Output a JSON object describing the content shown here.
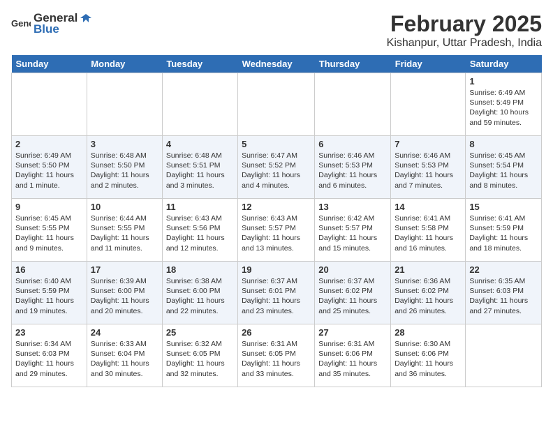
{
  "header": {
    "logo_general": "General",
    "logo_blue": "Blue",
    "title": "February 2025",
    "subtitle": "Kishanpur, Uttar Pradesh, India"
  },
  "days_of_week": [
    "Sunday",
    "Monday",
    "Tuesday",
    "Wednesday",
    "Thursday",
    "Friday",
    "Saturday"
  ],
  "weeks": [
    {
      "cells": [
        {
          "date": "",
          "content": ""
        },
        {
          "date": "",
          "content": ""
        },
        {
          "date": "",
          "content": ""
        },
        {
          "date": "",
          "content": ""
        },
        {
          "date": "",
          "content": ""
        },
        {
          "date": "",
          "content": ""
        },
        {
          "date": "1",
          "content": "Sunrise: 6:49 AM\nSunset: 5:49 PM\nDaylight: 10 hours and 59 minutes."
        }
      ]
    },
    {
      "cells": [
        {
          "date": "2",
          "content": "Sunrise: 6:49 AM\nSunset: 5:50 PM\nDaylight: 11 hours and 1 minute."
        },
        {
          "date": "3",
          "content": "Sunrise: 6:48 AM\nSunset: 5:50 PM\nDaylight: 11 hours and 2 minutes."
        },
        {
          "date": "4",
          "content": "Sunrise: 6:48 AM\nSunset: 5:51 PM\nDaylight: 11 hours and 3 minutes."
        },
        {
          "date": "5",
          "content": "Sunrise: 6:47 AM\nSunset: 5:52 PM\nDaylight: 11 hours and 4 minutes."
        },
        {
          "date": "6",
          "content": "Sunrise: 6:46 AM\nSunset: 5:53 PM\nDaylight: 11 hours and 6 minutes."
        },
        {
          "date": "7",
          "content": "Sunrise: 6:46 AM\nSunset: 5:53 PM\nDaylight: 11 hours and 7 minutes."
        },
        {
          "date": "8",
          "content": "Sunrise: 6:45 AM\nSunset: 5:54 PM\nDaylight: 11 hours and 8 minutes."
        }
      ]
    },
    {
      "cells": [
        {
          "date": "9",
          "content": "Sunrise: 6:45 AM\nSunset: 5:55 PM\nDaylight: 11 hours and 9 minutes."
        },
        {
          "date": "10",
          "content": "Sunrise: 6:44 AM\nSunset: 5:55 PM\nDaylight: 11 hours and 11 minutes."
        },
        {
          "date": "11",
          "content": "Sunrise: 6:43 AM\nSunset: 5:56 PM\nDaylight: 11 hours and 12 minutes."
        },
        {
          "date": "12",
          "content": "Sunrise: 6:43 AM\nSunset: 5:57 PM\nDaylight: 11 hours and 13 minutes."
        },
        {
          "date": "13",
          "content": "Sunrise: 6:42 AM\nSunset: 5:57 PM\nDaylight: 11 hours and 15 minutes."
        },
        {
          "date": "14",
          "content": "Sunrise: 6:41 AM\nSunset: 5:58 PM\nDaylight: 11 hours and 16 minutes."
        },
        {
          "date": "15",
          "content": "Sunrise: 6:41 AM\nSunset: 5:59 PM\nDaylight: 11 hours and 18 minutes."
        }
      ]
    },
    {
      "cells": [
        {
          "date": "16",
          "content": "Sunrise: 6:40 AM\nSunset: 5:59 PM\nDaylight: 11 hours and 19 minutes."
        },
        {
          "date": "17",
          "content": "Sunrise: 6:39 AM\nSunset: 6:00 PM\nDaylight: 11 hours and 20 minutes."
        },
        {
          "date": "18",
          "content": "Sunrise: 6:38 AM\nSunset: 6:00 PM\nDaylight: 11 hours and 22 minutes."
        },
        {
          "date": "19",
          "content": "Sunrise: 6:37 AM\nSunset: 6:01 PM\nDaylight: 11 hours and 23 minutes."
        },
        {
          "date": "20",
          "content": "Sunrise: 6:37 AM\nSunset: 6:02 PM\nDaylight: 11 hours and 25 minutes."
        },
        {
          "date": "21",
          "content": "Sunrise: 6:36 AM\nSunset: 6:02 PM\nDaylight: 11 hours and 26 minutes."
        },
        {
          "date": "22",
          "content": "Sunrise: 6:35 AM\nSunset: 6:03 PM\nDaylight: 11 hours and 27 minutes."
        }
      ]
    },
    {
      "cells": [
        {
          "date": "23",
          "content": "Sunrise: 6:34 AM\nSunset: 6:03 PM\nDaylight: 11 hours and 29 minutes."
        },
        {
          "date": "24",
          "content": "Sunrise: 6:33 AM\nSunset: 6:04 PM\nDaylight: 11 hours and 30 minutes."
        },
        {
          "date": "25",
          "content": "Sunrise: 6:32 AM\nSunset: 6:05 PM\nDaylight: 11 hours and 32 minutes."
        },
        {
          "date": "26",
          "content": "Sunrise: 6:31 AM\nSunset: 6:05 PM\nDaylight: 11 hours and 33 minutes."
        },
        {
          "date": "27",
          "content": "Sunrise: 6:31 AM\nSunset: 6:06 PM\nDaylight: 11 hours and 35 minutes."
        },
        {
          "date": "28",
          "content": "Sunrise: 6:30 AM\nSunset: 6:06 PM\nDaylight: 11 hours and 36 minutes."
        },
        {
          "date": "",
          "content": ""
        }
      ]
    }
  ]
}
